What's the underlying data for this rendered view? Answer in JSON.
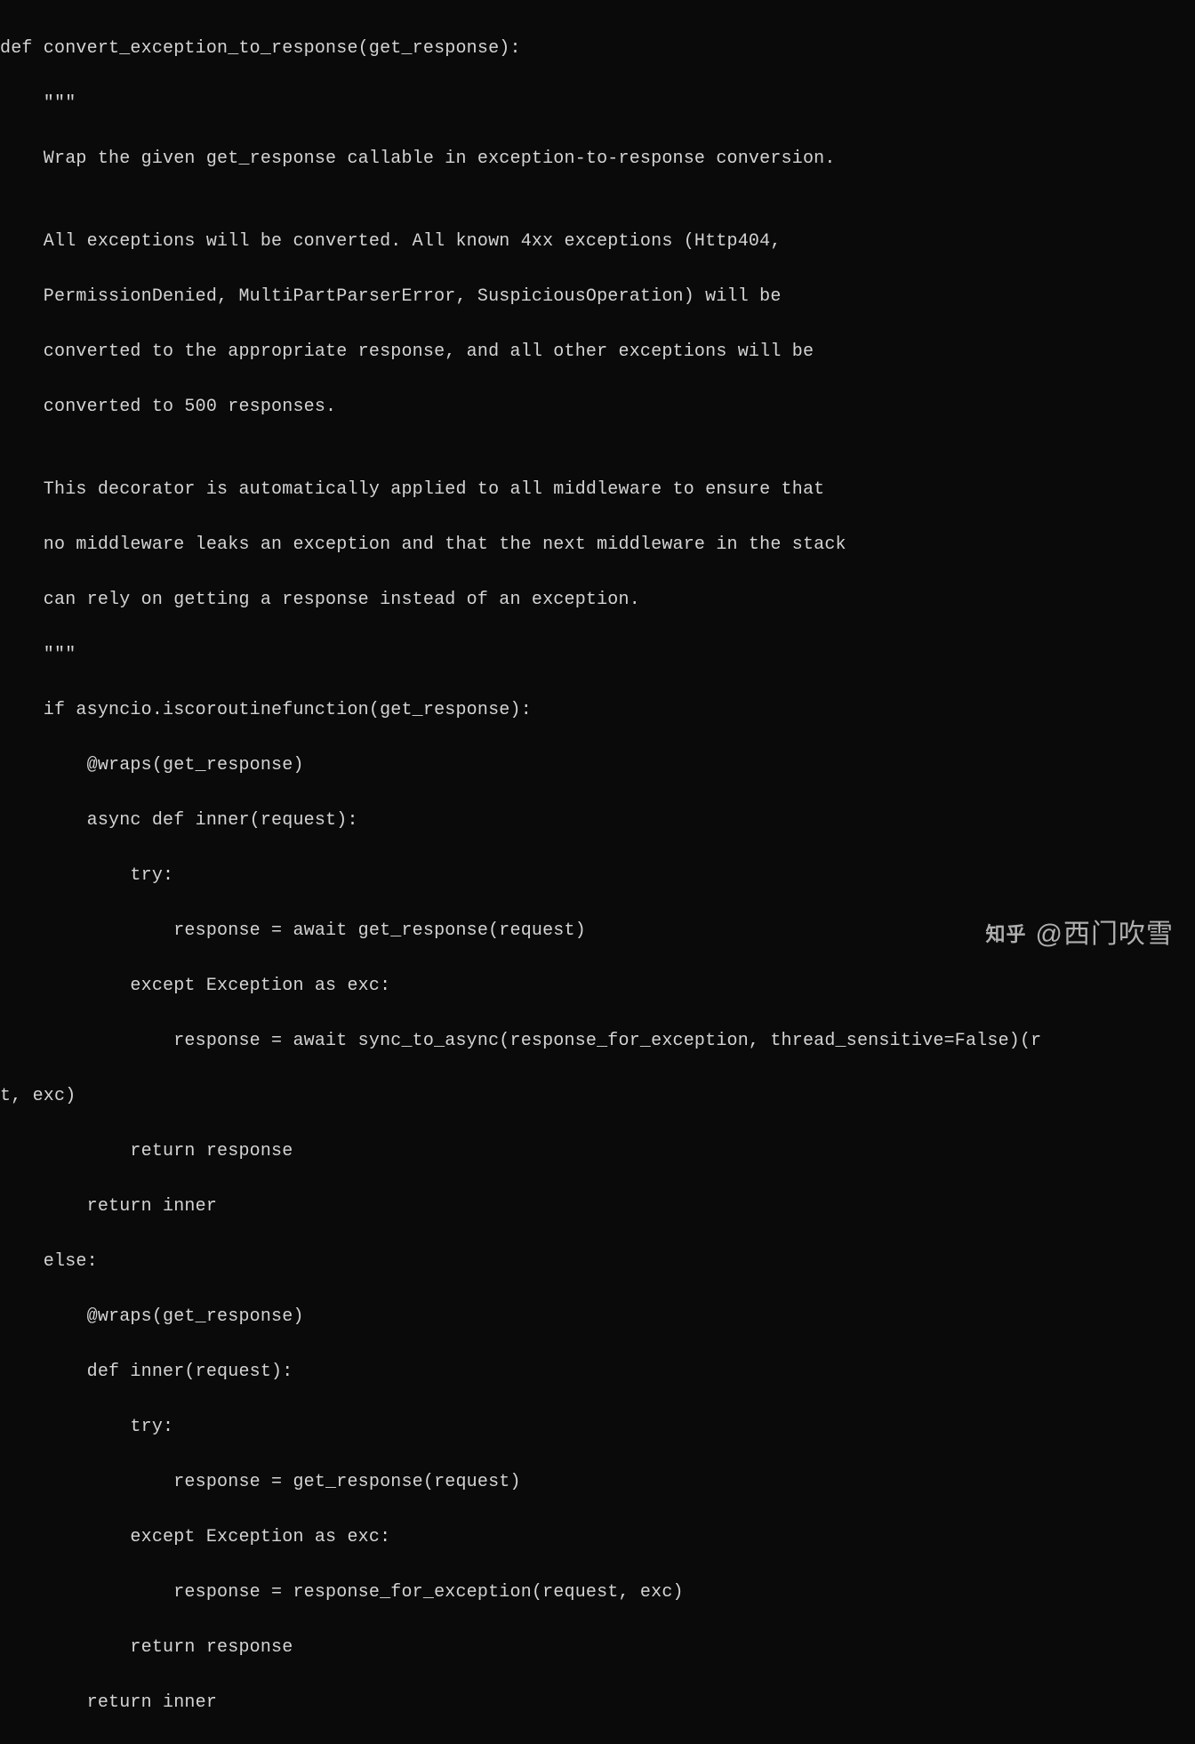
{
  "code": {
    "l01": "def convert_exception_to_response(get_response):",
    "l02": "    \"\"\"",
    "l03": "    Wrap the given get_response callable in exception-to-response conversion.",
    "l04": "",
    "l05": "    All exceptions will be converted. All known 4xx exceptions (Http404,",
    "l06": "    PermissionDenied, MultiPartParserError, SuspiciousOperation) will be",
    "l07": "    converted to the appropriate response, and all other exceptions will be",
    "l08": "    converted to 500 responses.",
    "l09": "",
    "l10": "    This decorator is automatically applied to all middleware to ensure that",
    "l11": "    no middleware leaks an exception and that the next middleware in the stack",
    "l12": "    can rely on getting a response instead of an exception.",
    "l13": "    \"\"\"",
    "l14": "    if asyncio.iscoroutinefunction(get_response):",
    "l15": "        @wraps(get_response)",
    "l16": "        async def inner(request):",
    "l17": "            try:",
    "l18": "                response = await get_response(request)",
    "l19": "            except Exception as exc:",
    "l20": "                response = await sync_to_async(response_for_exception, thread_sensitive=False)(r",
    "l21": "t, exc)",
    "l22": "            return response",
    "l23": "        return inner",
    "l24": "    else:",
    "l25": "        @wraps(get_response)",
    "l26": "        def inner(request):",
    "l27": "            try:",
    "l28": "                response = get_response(request)",
    "l29": "            except Exception as exc:",
    "l30": "                response = response_for_exception(request, exc)",
    "l31": "            return response",
    "l32": "        return inner"
  },
  "watermark": {
    "logo_cn": "知乎",
    "author": "@西门吹雪"
  }
}
